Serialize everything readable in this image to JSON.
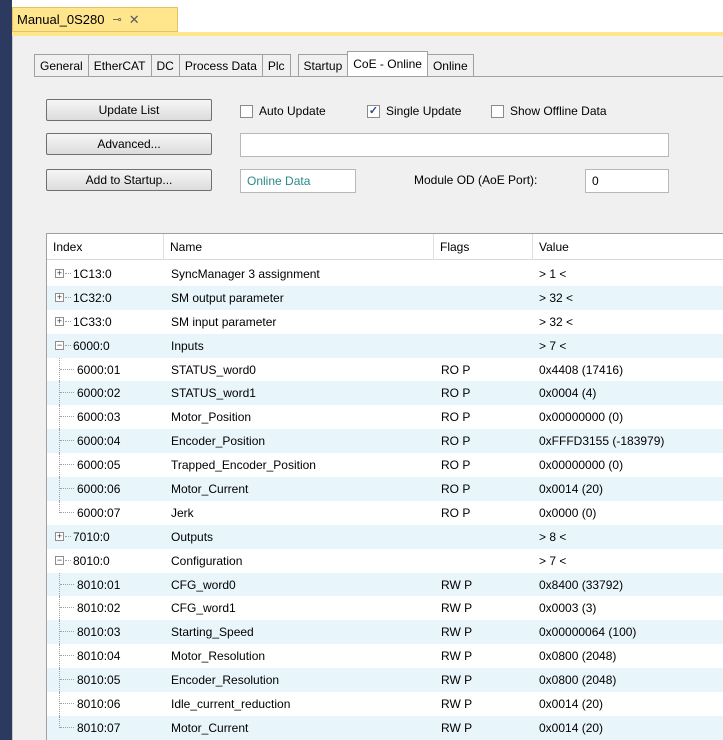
{
  "doc_tab": {
    "title": "Manual_0S280",
    "pin": "⊸",
    "close": "✕"
  },
  "tabs": [
    "General",
    "EtherCAT",
    "DC",
    "Process Data",
    "Plc",
    "Startup",
    "CoE - Online",
    "Online"
  ],
  "active_tab": "CoE - Online",
  "buttons": {
    "update_list": "Update List",
    "advanced": "Advanced...",
    "add_to_startup": "Add to Startup..."
  },
  "checkboxes": {
    "auto_update": {
      "label": "Auto Update",
      "checked": false
    },
    "single_update": {
      "label": "Single Update",
      "checked": true
    },
    "show_offline": {
      "label": "Show Offline Data",
      "checked": false
    }
  },
  "advanced_field_value": "",
  "online_data_label": "Online Data",
  "module_od_label": "Module OD (AoE Port):",
  "module_od_value": "0",
  "columns": {
    "index": "Index",
    "name": "Name",
    "flags": "Flags",
    "value": "Value"
  },
  "rows": [
    {
      "index": "1C13:0",
      "name": "SyncManager 3 assignment",
      "flags": "",
      "value": "> 1 <",
      "level": 0,
      "expander": "+"
    },
    {
      "index": "1C32:0",
      "name": "SM output parameter",
      "flags": "",
      "value": "> 32 <",
      "level": 0,
      "expander": "+"
    },
    {
      "index": "1C33:0",
      "name": "SM input parameter",
      "flags": "",
      "value": "> 32 <",
      "level": 0,
      "expander": "+"
    },
    {
      "index": "6000:0",
      "name": "Inputs",
      "flags": "",
      "value": "> 7 <",
      "level": 0,
      "expander": "−"
    },
    {
      "index": "6000:01",
      "name": "STATUS_word0",
      "flags": "RO P",
      "value": "0x4408 (17416)",
      "level": 1,
      "expander": ""
    },
    {
      "index": "6000:02",
      "name": "STATUS_word1",
      "flags": "RO P",
      "value": "0x0004 (4)",
      "level": 1,
      "expander": ""
    },
    {
      "index": "6000:03",
      "name": "Motor_Position",
      "flags": "RO P",
      "value": "0x00000000 (0)",
      "level": 1,
      "expander": ""
    },
    {
      "index": "6000:04",
      "name": "Encoder_Position",
      "flags": "RO P",
      "value": "0xFFFD3155 (-183979)",
      "level": 1,
      "expander": ""
    },
    {
      "index": "6000:05",
      "name": "Trapped_Encoder_Position",
      "flags": "RO P",
      "value": "0x00000000 (0)",
      "level": 1,
      "expander": ""
    },
    {
      "index": "6000:06",
      "name": "Motor_Current",
      "flags": "RO P",
      "value": "0x0014 (20)",
      "level": 1,
      "expander": ""
    },
    {
      "index": "6000:07",
      "name": "Jerk",
      "flags": "RO P",
      "value": "0x0000 (0)",
      "level": 1,
      "expander": ""
    },
    {
      "index": "7010:0",
      "name": "Outputs",
      "flags": "",
      "value": "> 8 <",
      "level": 0,
      "expander": "+"
    },
    {
      "index": "8010:0",
      "name": "Configuration",
      "flags": "",
      "value": "> 7 <",
      "level": 0,
      "expander": "−"
    },
    {
      "index": "8010:01",
      "name": "CFG_word0",
      "flags": "RW P",
      "value": "0x8400 (33792)",
      "level": 1,
      "expander": ""
    },
    {
      "index": "8010:02",
      "name": "CFG_word1",
      "flags": "RW P",
      "value": "0x0003 (3)",
      "level": 1,
      "expander": ""
    },
    {
      "index": "8010:03",
      "name": "Starting_Speed",
      "flags": "RW P",
      "value": "0x00000064 (100)",
      "level": 1,
      "expander": ""
    },
    {
      "index": "8010:04",
      "name": "Motor_Resolution",
      "flags": "RW P",
      "value": "0x0800 (2048)",
      "level": 1,
      "expander": ""
    },
    {
      "index": "8010:05",
      "name": "Encoder_Resolution",
      "flags": "RW P",
      "value": "0x0800 (2048)",
      "level": 1,
      "expander": ""
    },
    {
      "index": "8010:06",
      "name": "Idle_current_reduction",
      "flags": "RW P",
      "value": "0x0014 (20)",
      "level": 1,
      "expander": ""
    },
    {
      "index": "8010:07",
      "name": "Motor_Current",
      "flags": "RW P",
      "value": "0x0014 (20)",
      "level": 1,
      "expander": ""
    }
  ],
  "colors": {
    "doc_tab_bg": "#ffe58c",
    "row_alt": "#e8f6fb",
    "online_data_text": "#2a8a8a",
    "frame_bg": "#2b3a5e"
  }
}
